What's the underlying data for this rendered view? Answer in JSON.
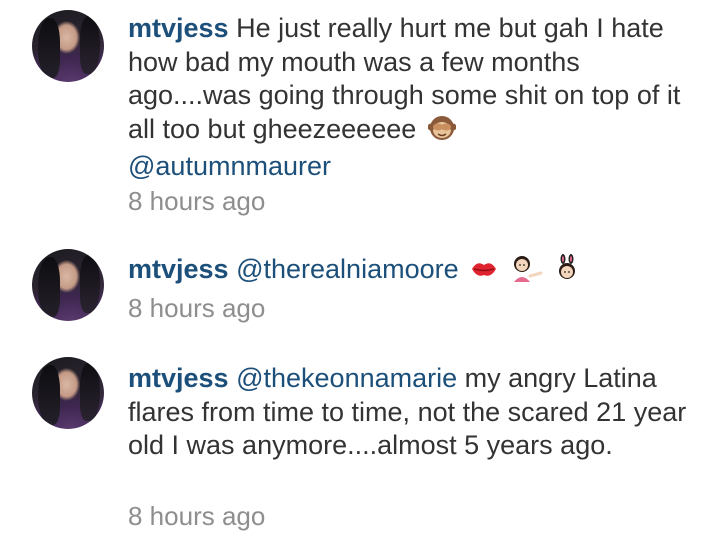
{
  "comments": [
    {
      "username": "mtvjess",
      "text_before": "He just really hurt me but gah I hate how bad my mouth was a few months ago....was going through some shit on top of it all too but gheezeeeeee",
      "emoji_icons": [
        "see-no-evil-monkey-icon"
      ],
      "mention_after": "@autumnmaurer",
      "time": "8 hours ago"
    },
    {
      "username": "mtvjess",
      "mention": "@therealniamoore",
      "emoji_icons": [
        "kiss-lips-icon",
        "woman-tipping-hand-icon",
        "bunny-girl-icon"
      ],
      "time": "8 hours ago"
    },
    {
      "username": "mtvjess",
      "mention": "@thekeonnamarie",
      "text_after": "my angry Latina flares from time to time, not the scared 21 year old I was anymore....almost 5 years ago.",
      "time": "8 hours ago"
    }
  ],
  "colors": {
    "username": "#1c4f79",
    "body_text": "#333333",
    "timestamp": "#8e8e8e",
    "background": "#ffffff"
  }
}
